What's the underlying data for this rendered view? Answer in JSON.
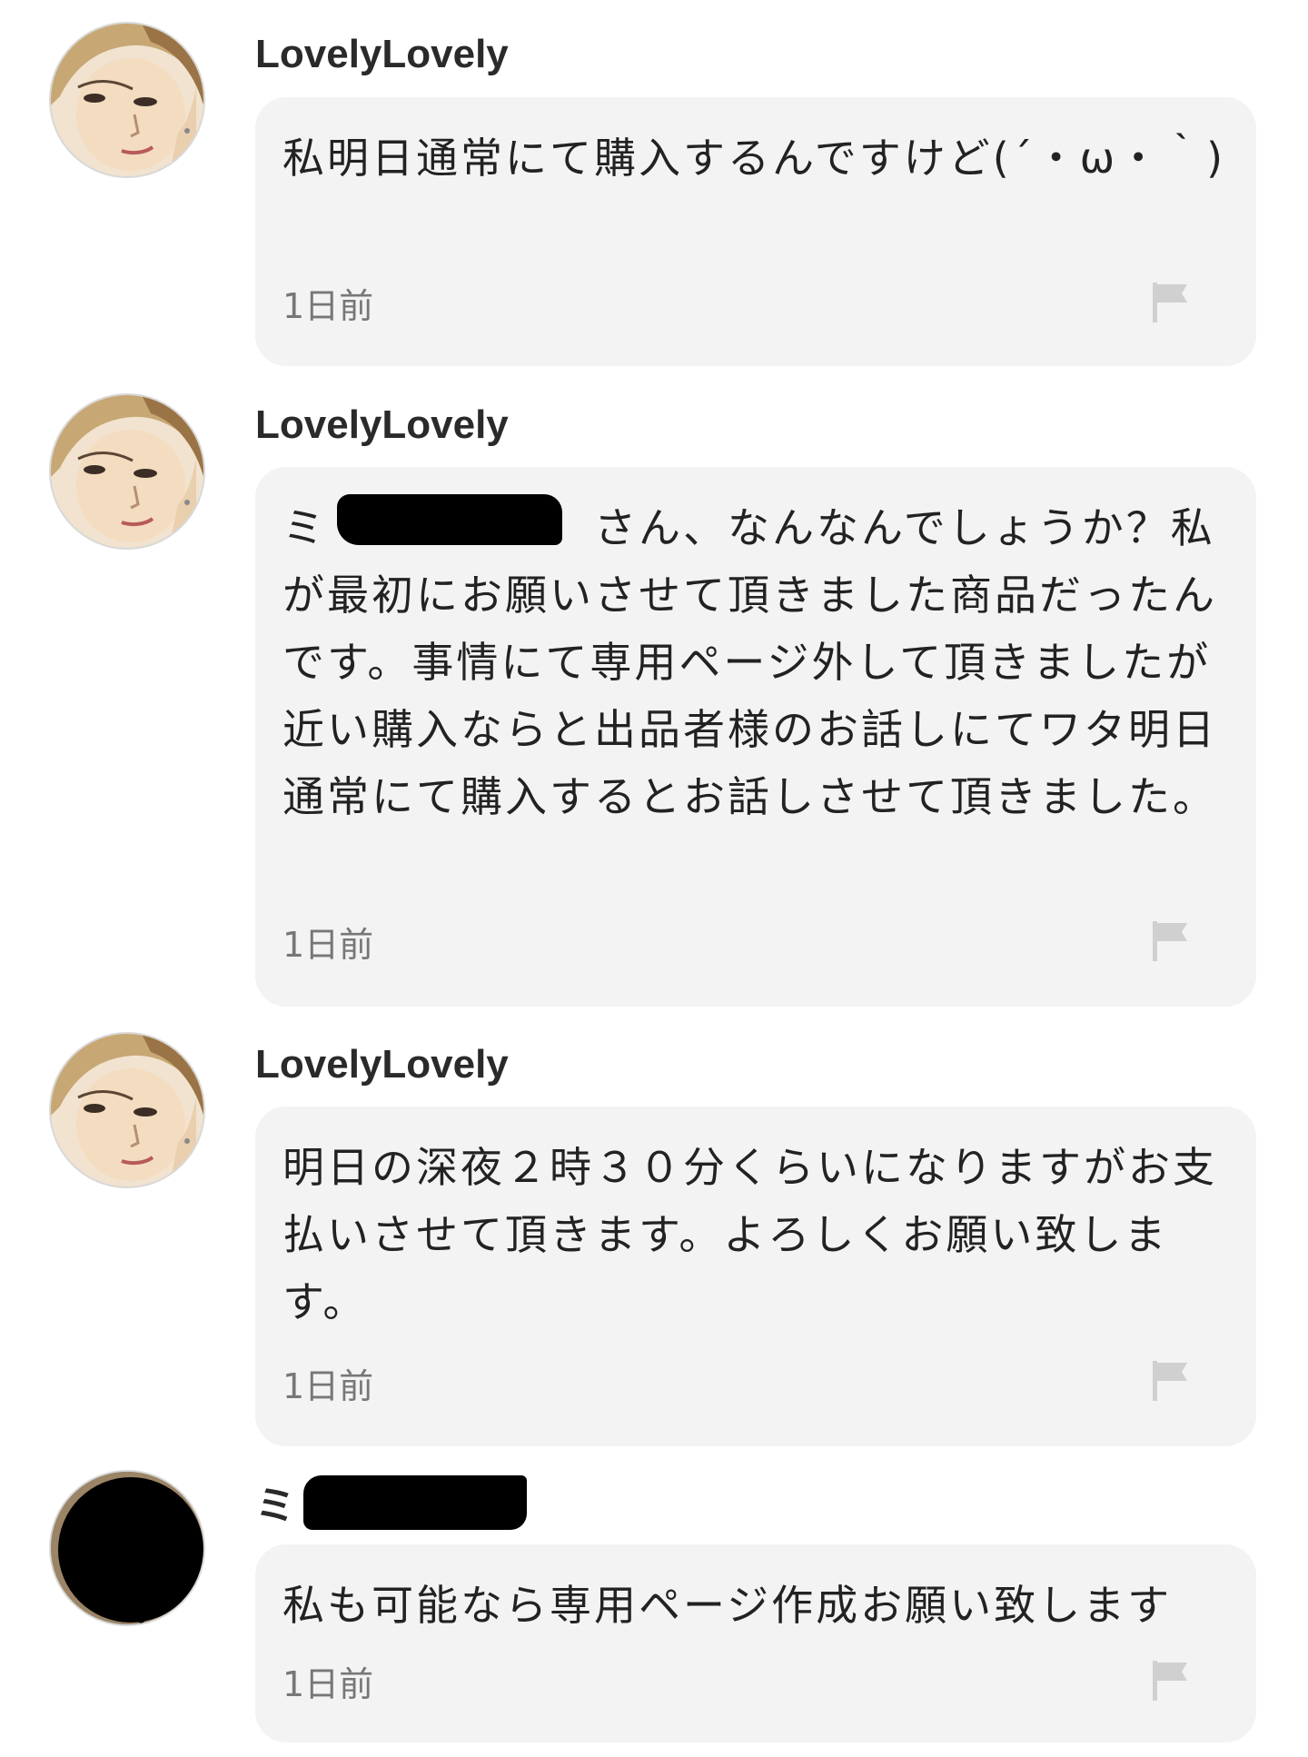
{
  "comments": [
    {
      "username": "LovelyLovely",
      "body": "私明日通常にて購入するんですけど(´・ω・｀)",
      "time": "1日前"
    },
    {
      "username": "LovelyLovely",
      "body": "ミ　　　　　　さん、なんなんでしょうか？私が最初にお願いさせて頂きました商品だったんです。事情にて専用ページ外して頂きましたが近い購入ならと出品者様のお話しにてワタ明日通常にて購入するとお話しさせて頂きました。",
      "time": "1日前"
    },
    {
      "username": "LovelyLovely",
      "body": "明日の深夜２時３０分くらいになりますがお支払いさせて頂きます。よろしくお願い致します。",
      "time": "1日前"
    },
    {
      "username": "ミ",
      "body": "私も可能なら専用ページ作成お願い致します",
      "time": "1日前"
    }
  ],
  "icons": {
    "avatar": "user-avatar-photo",
    "report": "flag-icon"
  },
  "colors": {
    "bubble": "#f3f3f3",
    "timestamp": "#777777",
    "flag": "#d0d0d0",
    "redaction": "#000000"
  }
}
